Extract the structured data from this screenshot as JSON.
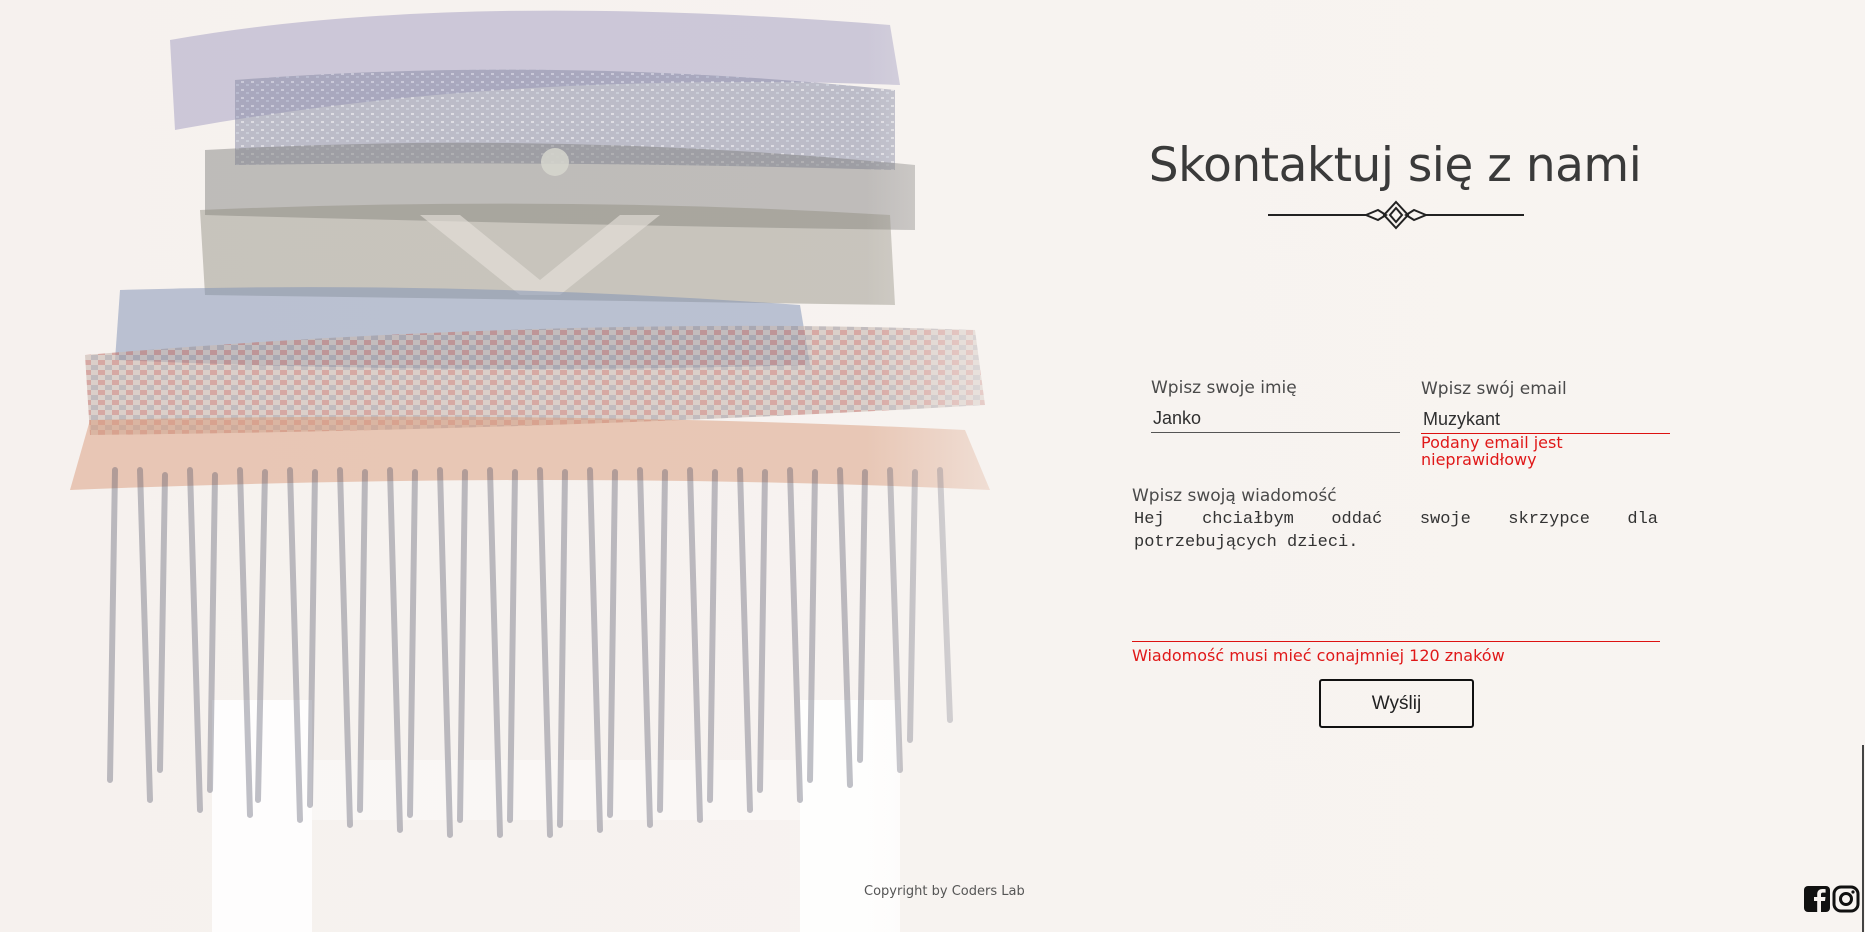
{
  "contact": {
    "title": "Skontaktuj się z nami",
    "name_label": "Wpisz swoje imię",
    "name_value": "Janko",
    "email_label": "Wpisz swój email",
    "email_value": "Muzykant",
    "email_error_line1": "Podany email jest",
    "email_error_line2": "nieprawidłowy",
    "message_label": "Wpisz swoją wiadomość",
    "message_value": "Hej chciałbym oddać swoje skrzypce dla potrzebujących dzieci.",
    "message_error": "Wiadomość musi mieć conajmniej 120 znaków",
    "submit_label": "Wyślij"
  },
  "footer": {
    "copyright": "Copyright by Coders Lab",
    "social": [
      "facebook-icon",
      "instagram-icon"
    ]
  },
  "colors": {
    "error": "#e01818",
    "text": "#333333",
    "background": "#f7f3f0"
  }
}
